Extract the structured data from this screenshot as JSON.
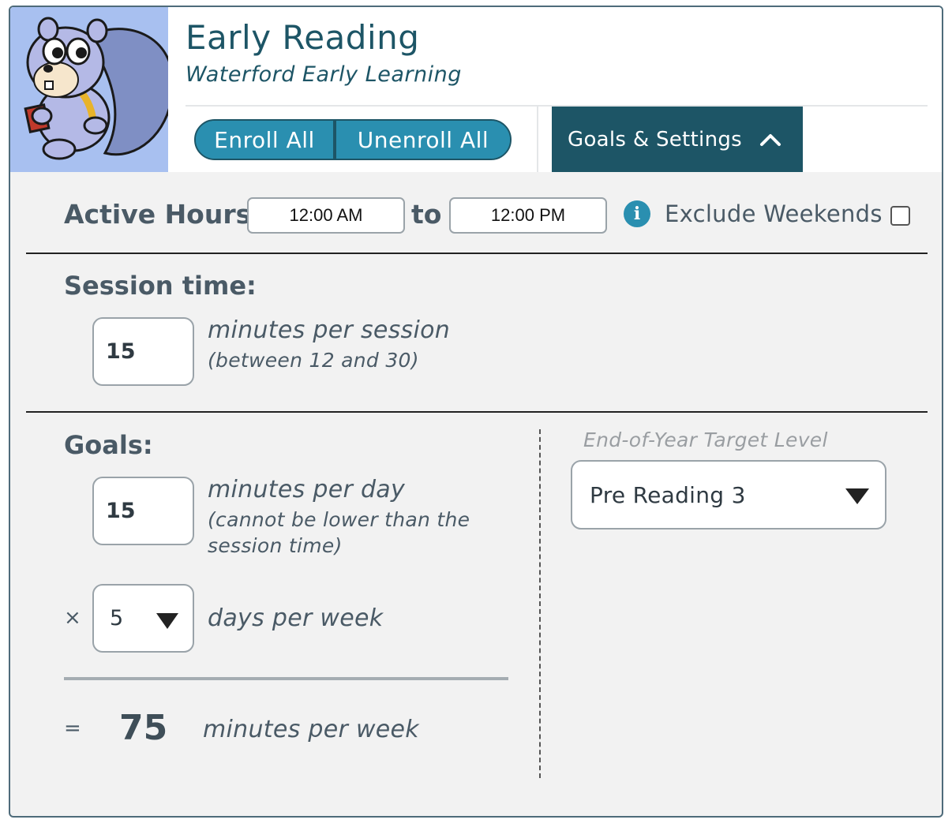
{
  "header": {
    "title": "Early Reading",
    "subtitle": "Waterford Early Learning",
    "enroll_all": "Enroll All",
    "unenroll_all": "Unenroll All",
    "goals_settings": "Goals & Settings",
    "mascot_icon": "squirrel-mascot-icon"
  },
  "active_hours": {
    "label": "Active Hours",
    "start": "12:00 AM",
    "to": "to",
    "end": "12:00 PM",
    "exclude_weekends_label": "Exclude Weekends",
    "exclude_weekends_checked": false,
    "info_icon": "i"
  },
  "session": {
    "label": "Session time:",
    "value": "15",
    "unit": "minutes per session",
    "hint": "(between 12 and 30)"
  },
  "goals": {
    "label": "Goals:",
    "minutes_value": "15",
    "minutes_unit": "minutes per day",
    "minutes_hint_1": "(cannot be lower than the",
    "minutes_hint_2": "session time)",
    "times_symbol": "×",
    "days_value": "5",
    "days_unit": "days per week",
    "equals_symbol": "=",
    "total_value": "75",
    "total_unit": "minutes per week"
  },
  "target": {
    "label": "End-of-Year Target Level",
    "value": "Pre Reading 3"
  },
  "colors": {
    "brand_dark": "#1d5566",
    "brand_button": "#2a8fb0",
    "panel_bg": "#f2f2f2",
    "mascot_bg": "#a8c0f0"
  }
}
